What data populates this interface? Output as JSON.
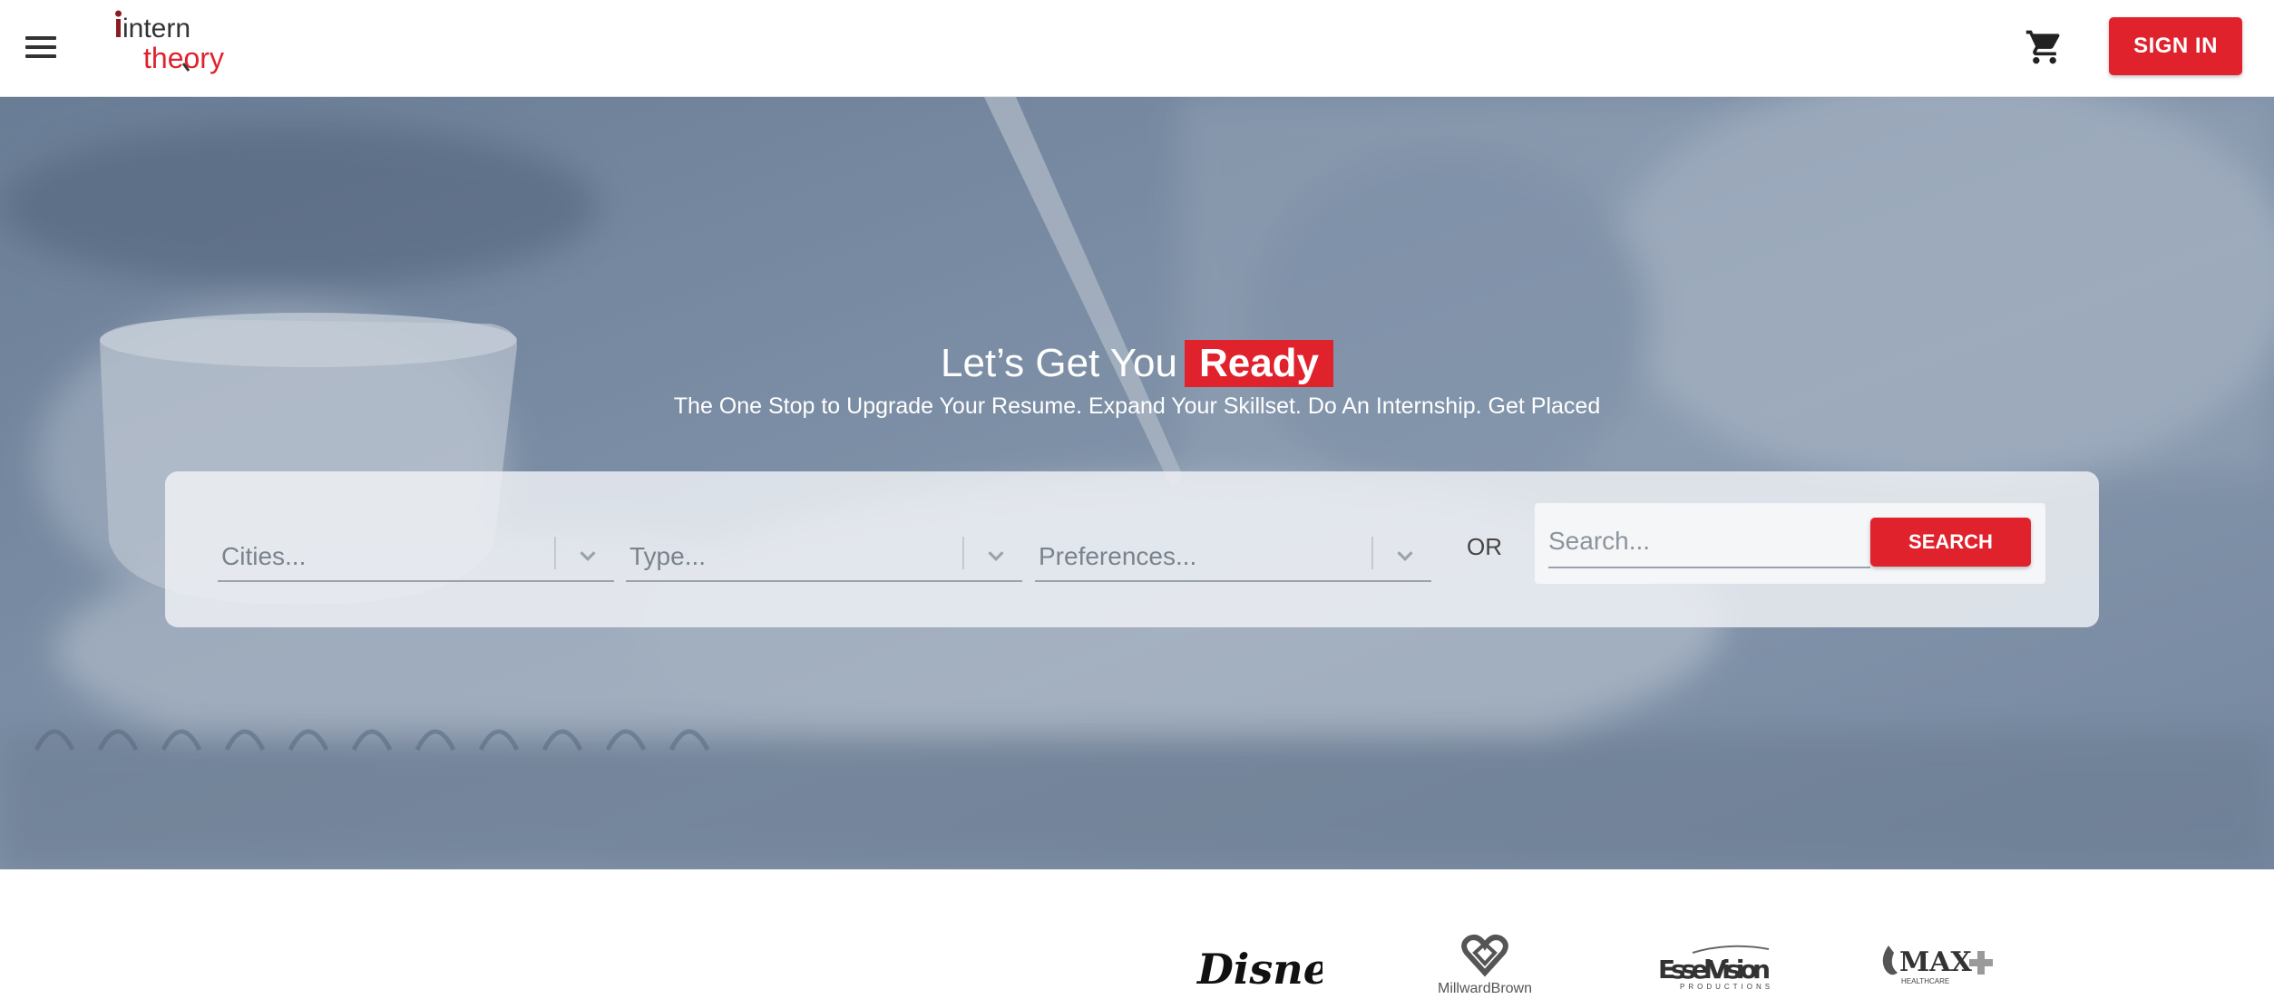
{
  "header": {
    "menu_icon": "hamburger-menu-icon",
    "logo": {
      "line1": "intern",
      "line2": "theory"
    },
    "cart_icon": "shopping-cart-icon",
    "signin_label": "SIGN IN"
  },
  "hero": {
    "title_prefix": "Let’s Get You",
    "title_highlight": "Ready",
    "subtitle": "The One Stop to Upgrade Your Resume. Expand Your Skillset. Do An Internship. Get Placed",
    "filters": {
      "cities": {
        "placeholder": "Cities..."
      },
      "type": {
        "placeholder": "Type..."
      },
      "preferences": {
        "placeholder": "Preferences..."
      }
    },
    "or_label": "OR",
    "search": {
      "placeholder": "Search...",
      "button_label": "SEARCH"
    }
  },
  "partners": {
    "logos": [
      {
        "name": "Disney",
        "text": "Disney"
      },
      {
        "name": "Millward Brown",
        "text": "MillwardBrown"
      },
      {
        "name": "Essel Vision",
        "text": "EsselVision",
        "sub": "PRODUCTIONS"
      },
      {
        "name": "Max Healthcare",
        "text": "MAX",
        "sub": "HEALTHCARE"
      }
    ]
  },
  "colors": {
    "accent": "#e0222d",
    "hero_overlay": "#7f90a6"
  }
}
